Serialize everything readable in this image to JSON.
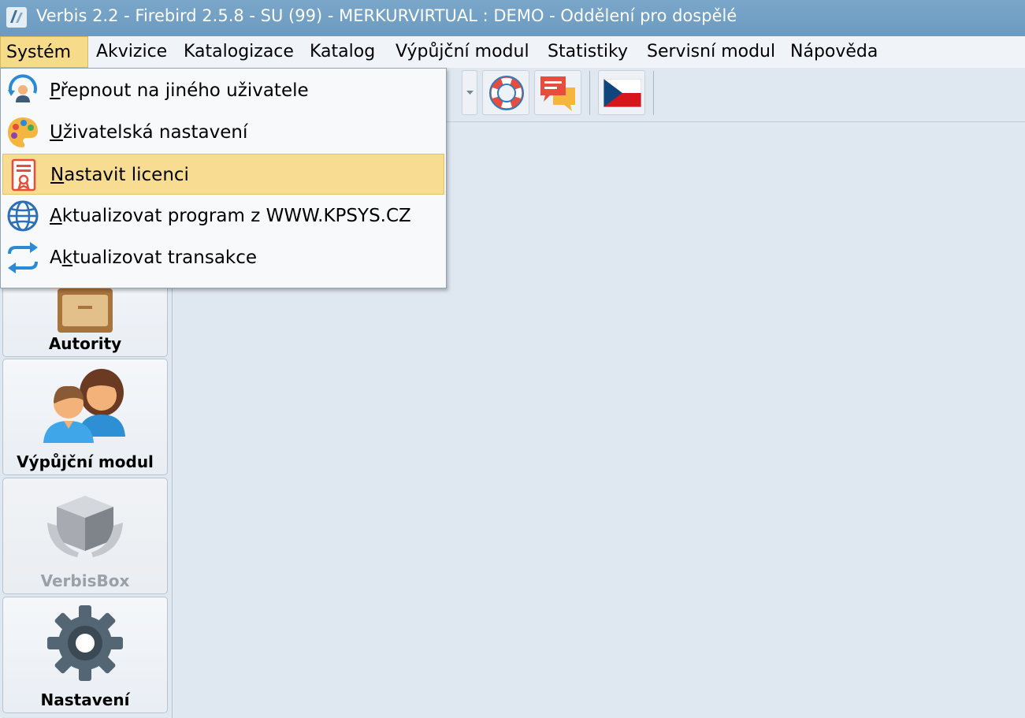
{
  "window": {
    "title": "Verbis 2.2 - Firebird 2.5.8 - SU (99) - MERKURVIRTUAL : DEMO - Oddělení pro dospělé"
  },
  "menubar": {
    "items": [
      {
        "label": "Systém"
      },
      {
        "label": "Akvizice"
      },
      {
        "label": "Katalogizace"
      },
      {
        "label": "Katalog"
      },
      {
        "label": "Výpůjční modul"
      },
      {
        "label": "Statistiky"
      },
      {
        "label": "Servisní modul"
      },
      {
        "label": "Nápověda"
      }
    ]
  },
  "system_menu": {
    "items": [
      {
        "first": "P",
        "rest": "řepnout na jiného uživatele",
        "icon": "switch-user-icon"
      },
      {
        "first": "U",
        "rest": "živatelská nastavení",
        "icon": "palette-icon"
      },
      {
        "first": "N",
        "rest": "astavit licenci",
        "icon": "license-certificate-icon"
      },
      {
        "first": "A",
        "rest": "ktualizovat program z WWW.KPSYS.CZ",
        "icon": "globe-icon"
      },
      {
        "pre": "A",
        "u": "k",
        "post": "tualizovat transakce",
        "icon": "sync-arrows-icon"
      }
    ]
  },
  "toolbar": {
    "icons": [
      "dropdown-arrow-icon",
      "lifebuoy-help-icon",
      "chat-bubbles-icon",
      "czech-flag-icon"
    ]
  },
  "leftpanel": {
    "buttons": [
      {
        "label": "Autority",
        "icon": "cabinet-icon"
      },
      {
        "label": "Výpůjční modul",
        "icon": "users-icon"
      },
      {
        "label": "VerbisBox",
        "icon": "box-hands-icon"
      },
      {
        "label": "Nastavení",
        "icon": "gear-icon"
      }
    ]
  },
  "colors": {
    "titlebar": "#6d9bc0",
    "menu_highlight": "#f7dc91",
    "background": "#dfe7f0"
  }
}
